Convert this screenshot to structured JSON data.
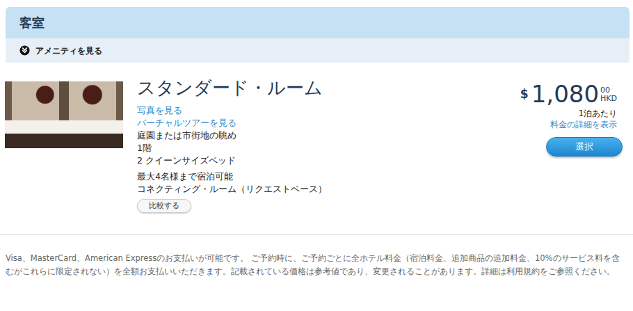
{
  "section": {
    "title": "客室"
  },
  "amenities": {
    "label": "アメニティを見る",
    "expanded": false
  },
  "room": {
    "title": "スタンダード・ルーム",
    "links": [
      "写真を見る",
      "バーチャルツアーを見る"
    ],
    "features": [
      "庭園または市街地の眺め",
      "1階",
      "2 クイーンサイズベッド"
    ],
    "notes": [
      "最大4名様まで宿泊可能",
      "コネクティング・ルーム（リクエストベース）"
    ],
    "compare_button": "比較する",
    "price": {
      "currency_symbol": "$",
      "amount": "1,080",
      "cents": "00",
      "currency": "HKD",
      "per": "1泊あたり",
      "details_link": "料金の詳細を表示"
    },
    "select_button": "選択"
  },
  "footer": "Visa、MasterCard、American Expressのお支払いが可能です。 ご予約時に、ご予約ごとに全ホテル料金（宿泊料金、追加商品の追加料金、10%のサービス料を含むがこれらに限定されない）を全額お支払いいただきます。記載されている価格は参考値であり、変更されることがあります。詳細は利用規約をご参照ください。"
}
